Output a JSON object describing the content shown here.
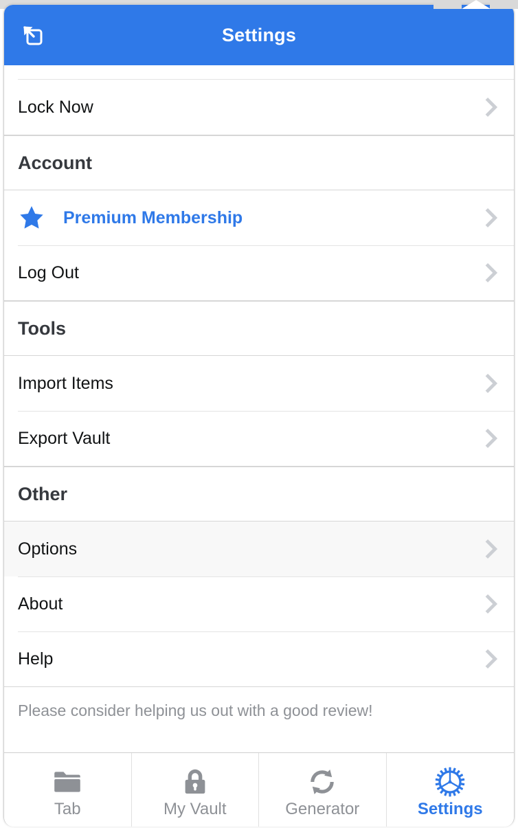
{
  "header": {
    "title": "Settings",
    "popout_icon": "popout-window-icon",
    "background_color": "#2f79e8",
    "title_color": "#ffffff"
  },
  "colors": {
    "accent": "#2f79e8",
    "text": "#111314",
    "section_header_text": "#36393e",
    "muted_text": "#8e9196",
    "chevron": "#cccfd4",
    "row_active_background": "#f8f8f8"
  },
  "content": {
    "groups": [
      {
        "name": "security",
        "header": null,
        "rows": [
          {
            "label": "Lock Now",
            "name": "lock-now",
            "lead_icon": null,
            "style": "default",
            "active": false,
            "chevron": true
          }
        ]
      },
      {
        "name": "account",
        "header": "Account",
        "rows": [
          {
            "label": "Premium Membership",
            "name": "premium-membership",
            "lead_icon": "star-icon",
            "style": "premium",
            "active": false,
            "chevron": true
          },
          {
            "label": "Log Out",
            "name": "log-out",
            "lead_icon": null,
            "style": "default",
            "active": false,
            "chevron": true
          }
        ]
      },
      {
        "name": "tools",
        "header": "Tools",
        "rows": [
          {
            "label": "Import Items",
            "name": "import-items",
            "lead_icon": null,
            "style": "default",
            "active": false,
            "chevron": true
          },
          {
            "label": "Export Vault",
            "name": "export-vault",
            "lead_icon": null,
            "style": "default",
            "active": false,
            "chevron": true
          }
        ]
      },
      {
        "name": "other",
        "header": "Other",
        "rows": [
          {
            "label": "Options",
            "name": "options",
            "lead_icon": null,
            "style": "default",
            "active": true,
            "chevron": true
          },
          {
            "label": "About",
            "name": "about",
            "lead_icon": null,
            "style": "default",
            "active": false,
            "chevron": true
          },
          {
            "label": "Help",
            "name": "help",
            "lead_icon": null,
            "style": "default",
            "active": false,
            "chevron": true
          }
        ]
      }
    ],
    "review_note": "Please consider helping us out with a good review!"
  },
  "tab_bar": {
    "items": [
      {
        "label": "Tab",
        "icon": "folder-icon",
        "active": false
      },
      {
        "label": "My Vault",
        "icon": "lock-icon",
        "active": false
      },
      {
        "label": "Generator",
        "icon": "refresh-icon",
        "active": false
      },
      {
        "label": "Settings",
        "icon": "gear-icon",
        "active": true
      }
    ]
  }
}
